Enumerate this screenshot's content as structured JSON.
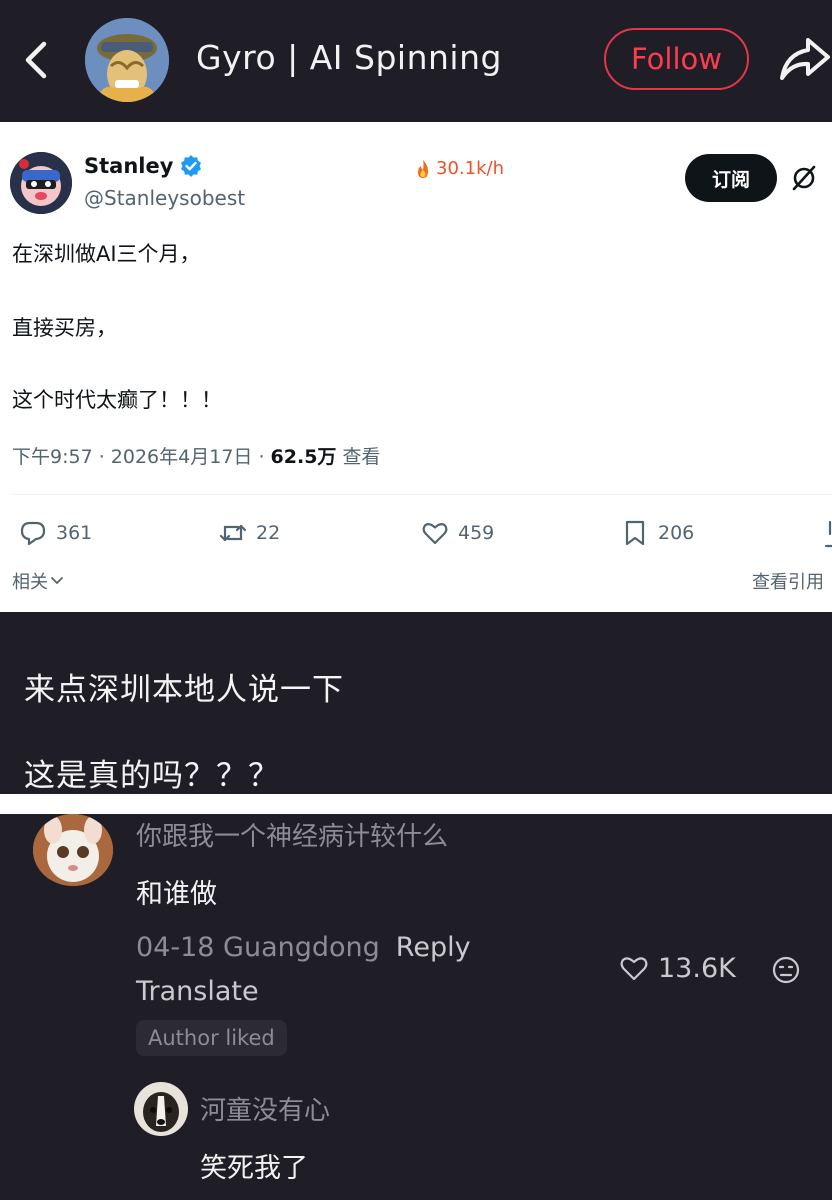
{
  "header": {
    "title": "Gyro | AI Spinning",
    "follow_label": "Follow",
    "icons": [
      "chevron-left-icon",
      "avatar",
      "share-icon"
    ]
  },
  "tweet": {
    "name": "Stanley",
    "handle": "@Stanleysobest",
    "hot_rate": "30.1k/h",
    "subscribe_label": "订阅",
    "lines": [
      "在深圳做AI三个月，",
      "直接买房，",
      "这个时代太癫了！！！"
    ],
    "time": "下午9:57 · 2026年4月17日 · ",
    "views": "62.5万",
    "views_suffix": " 查看",
    "actions": {
      "replies": "361",
      "retweets": "22",
      "likes": "459",
      "bookmarks": "206"
    },
    "related_label": "相关",
    "quotes_label": "查看引用"
  },
  "caption": {
    "line1": "来点深圳本地人说一下",
    "line2": "这是真的吗？？？"
  },
  "comment": {
    "user": "你跟我一个神经病计较什么",
    "text": "和谁做",
    "date_location": "04-18 Guangdong",
    "reply_label": "Reply",
    "translate_label": "Translate",
    "badge": "Author liked",
    "likes": "13.6K"
  },
  "reply": {
    "user": "河童没有心",
    "text": "笑死我了"
  },
  "colors": {
    "background": "#1f1e26",
    "follow_accent": "#ff3b52",
    "verified": "#1d9bf0",
    "hot": "#f0502a"
  }
}
